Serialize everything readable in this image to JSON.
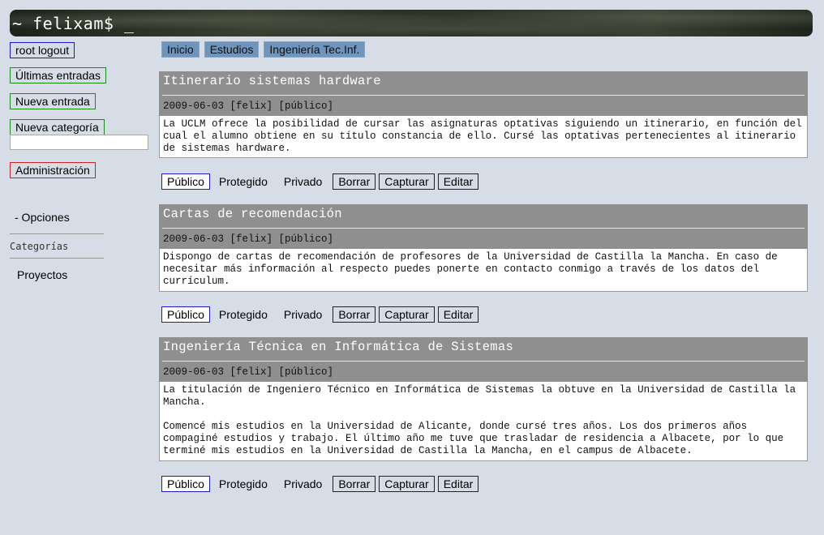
{
  "header": {
    "title": "~ felixam$ _"
  },
  "sidebar": {
    "root_logout": "root logout",
    "ultimas_entradas": "Últimas entradas",
    "nueva_entrada": "Nueva entrada",
    "nueva_categoria": "Nueva categoría",
    "nueva_categoria_value": "",
    "administracion": "Administración",
    "opciones": "- Opciones",
    "categorias_label": "Categorías",
    "categories": [
      "Proyectos"
    ]
  },
  "breadcrumb": [
    "Inicio",
    "Estudios",
    "Ingeniería Tec.Inf."
  ],
  "colors": {
    "background": "#d6dde6",
    "crumb": "#6f95bd",
    "post_header": "#8f8f8f"
  },
  "posts": [
    {
      "title": "Itinerario sistemas hardware",
      "meta": "2009-06-03 [felix] [público]",
      "body": [
        "La UCLM ofrece la posibilidad de cursar las asignaturas optativas siguiendo un itinerario, en función del cual el alumno obtiene en su título constancia de ello. Cursé las optativas pertenecientes al itinerario de sistemas hardware."
      ]
    },
    {
      "title": "Cartas de recomendación",
      "meta": "2009-06-03 [felix] [público]",
      "body": [
        "Dispongo de cartas de recomendación de profesores de la Universidad de Castilla la Mancha. En caso de necesitar más información al respecto puedes ponerte en contacto conmigo a través de los datos del currículum."
      ]
    },
    {
      "title": "Ingeniería Técnica en Informática de Sistemas",
      "meta": "2009-06-03 [felix] [público]",
      "body": [
        "La titulación de Ingeniero Técnico en Informática de Sistemas la obtuve en la Universidad de Castilla la Mancha.",
        "Comencé mis estudios en la Universidad de Alicante, donde cursé tres años. Los dos primeros años compaginé estudios y trabajo. El último año me tuve que trasladar de residencia a Albacete, por lo que terminé mis estudios en la Universidad de Castilla la Mancha, en el campus de Albacete."
      ]
    }
  ],
  "actions": {
    "publico": "Público",
    "protegido": "Protegido",
    "privado": "Privado",
    "borrar": "Borrar",
    "capturar": "Capturar",
    "editar": "Editar"
  }
}
